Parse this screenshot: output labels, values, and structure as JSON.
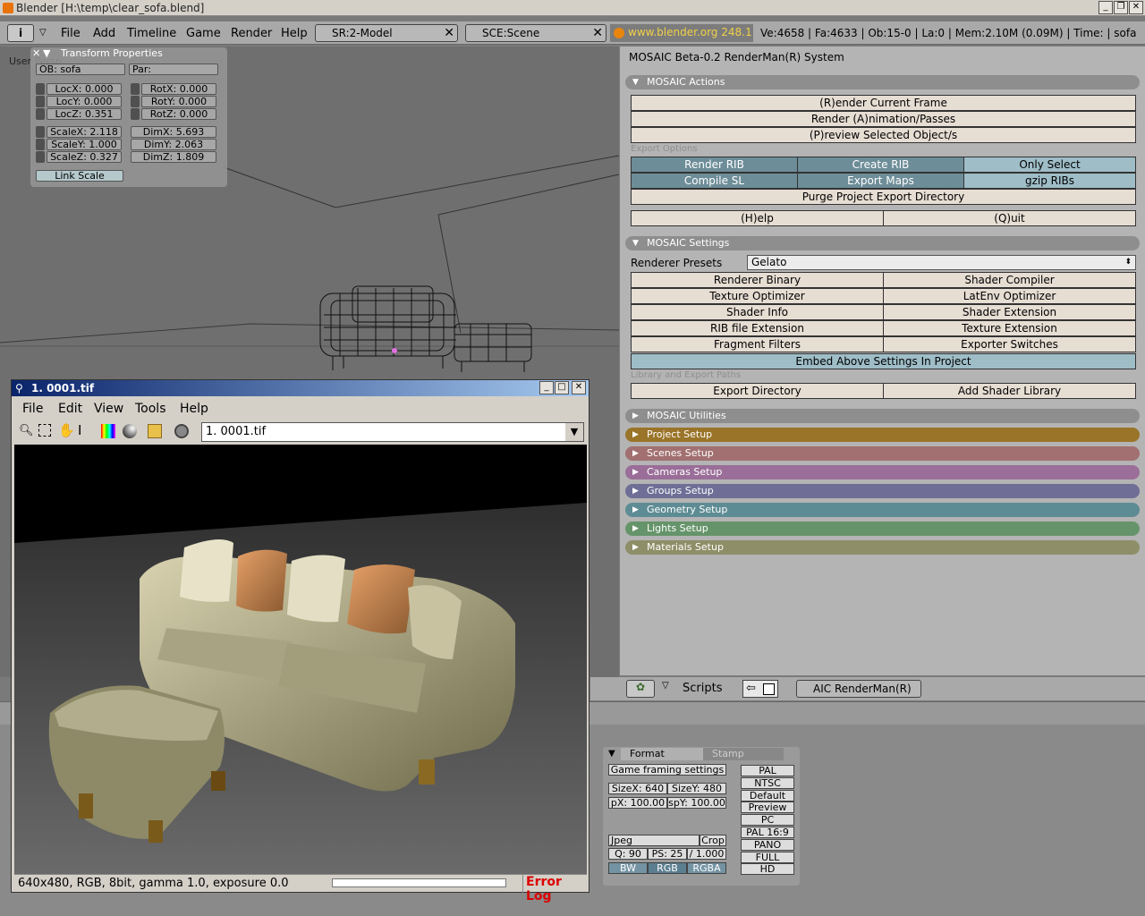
{
  "window": {
    "title": "Blender [H:\\temp\\clear_sofa.blend]"
  },
  "topbar": {
    "menus": [
      "File",
      "Add",
      "Timeline",
      "Game",
      "Render",
      "Help"
    ],
    "screen": "SR:2-Model",
    "scene": "SCE:Scene",
    "website": "www.blender.org 248.1",
    "stats": "Ve:4658 | Fa:4633 | Ob:15-0 | La:0  | Mem:2.10M (0.09M)  | Time: | sofa"
  },
  "viewport": {
    "label": "User Persp"
  },
  "transform": {
    "title": "Transform Properties",
    "ob": "OB: sofa",
    "par": "Par:",
    "locx": "LocX: 0.000",
    "locy": "LocY: 0.000",
    "locz": "LocZ: 0.351",
    "rotx": "RotX: 0.000",
    "roty": "RotY: 0.000",
    "rotz": "RotZ: 0.000",
    "scalex": "ScaleX: 2.118",
    "scaley": "ScaleY: 1.000",
    "scalez": "ScaleZ: 0.327",
    "dimx": "DimX: 5.693",
    "dimy": "DimY: 2.063",
    "dimz": "DimZ: 1.809",
    "link_scale": "Link Scale"
  },
  "mosaic": {
    "title": "MOSAIC Beta-0.2 RenderMan(R) System",
    "actions_header": "MOSAIC Actions",
    "render_frame": "(R)ender Current Frame",
    "render_anim": "Render (A)nimation/Passes",
    "preview": "(P)review Selected Object/s",
    "export_options": "Export Options",
    "render_rib": "Render RIB",
    "create_rib": "Create RIB",
    "only_select": "Only Select",
    "compile_sl": "Compile SL",
    "export_maps": "Export Maps",
    "gzip_ribs": "gzip RIBs",
    "purge": "Purge Project Export Directory",
    "help": "(H)elp",
    "quit": "(Q)uit",
    "settings_header": "MOSAIC Settings",
    "renderer_presets_label": "Renderer Presets",
    "renderer_preset": "Gelato",
    "grid": [
      "Renderer Binary",
      "Shader Compiler",
      "Texture Optimizer",
      "LatEnv Optimizer",
      "Shader Info",
      "Shader Extension",
      "RIB file Extension",
      "Texture Extension",
      "Fragment Filters",
      "Exporter Switches"
    ],
    "embed": "Embed Above Settings In Project",
    "lib_paths": "Library and Export Paths",
    "export_dir": "Export Directory",
    "add_shader_lib": "Add Shader Library",
    "sections": [
      {
        "label": "MOSAIC Utilities",
        "color": "#8e8e8e"
      },
      {
        "label": "Project Setup",
        "color": "#9a7428"
      },
      {
        "label": "Scenes Setup",
        "color": "#a27070"
      },
      {
        "label": "Cameras Setup",
        "color": "#9a6e98"
      },
      {
        "label": "Groups Setup",
        "color": "#6e6e96"
      },
      {
        "label": "Geometry Setup",
        "color": "#5e8c94"
      },
      {
        "label": "Lights Setup",
        "color": "#66946a"
      },
      {
        "label": "Materials Setup",
        "color": "#8e8e68"
      }
    ]
  },
  "scripts_bar": {
    "label": "Scripts",
    "script": "AIC RenderMan(R)"
  },
  "format": {
    "tab_format": "Format",
    "tab_stamp": "Stamp",
    "game_framing": "Game framing settings",
    "sizex": "SizeX: 640",
    "sizey": "SizeY: 480",
    "px": "pX: 100.00",
    "spy": "spY: 100.00",
    "jpeg": "Jpeg",
    "crop": "Crop",
    "q": "Q: 90",
    "ps": "PS: 25",
    "fps": "/ 1.000",
    "bw": "BW",
    "rgb": "RGB",
    "rgba": "RGBA",
    "presets": [
      "PAL",
      "NTSC",
      "Default",
      "Preview",
      "PC",
      "PAL 16:9",
      "PANO",
      "FULL",
      "HD"
    ]
  },
  "image_viewer": {
    "title": "1. 0001.tif",
    "menus": [
      "File",
      "Edit",
      "View",
      "Tools",
      "Help"
    ],
    "file": "1. 0001.tif",
    "status": "640x480,  RGB,  8bit,  gamma 1.0, exposure 0.0",
    "error_log": "Error Log"
  }
}
